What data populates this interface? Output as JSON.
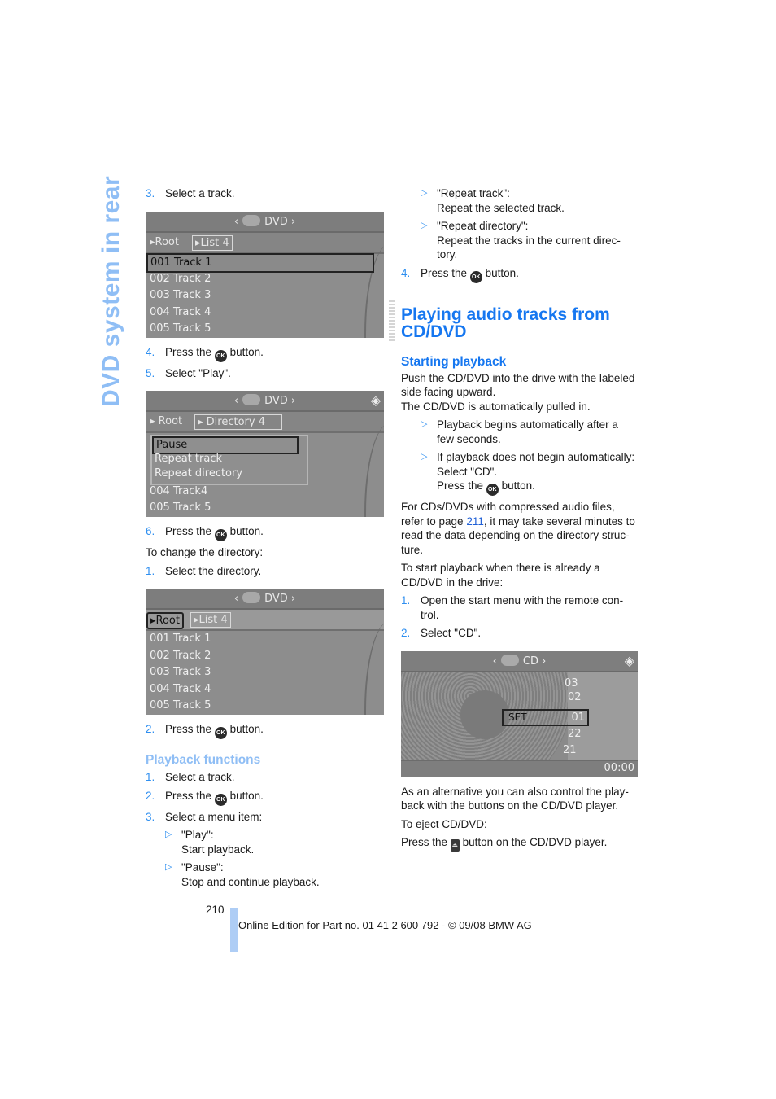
{
  "side_title": "DVD system in rear",
  "left": {
    "step3_select_track": {
      "num": "3.",
      "text": "Select a track."
    },
    "screen1": {
      "source": "DVD",
      "crumbs": [
        "Root",
        "List 4"
      ],
      "rows": [
        "001 Track  1",
        "002 Track  2",
        "003 Track  3",
        "004 Track  4",
        "005 Track  5"
      ],
      "selected_row": "001 Track  1"
    },
    "step4": {
      "num": "4.",
      "text_before": "Press the",
      "text_after": "button."
    },
    "step5": {
      "num": "5.",
      "text": "Select \"Play\"."
    },
    "screen2": {
      "source": "DVD",
      "crumbs": [
        "Root",
        "Directory  4"
      ],
      "popup_items": [
        "Pause",
        "Repeat track",
        "Repeat directory"
      ],
      "rows": [
        "004 Track4",
        "005 Track  5"
      ]
    },
    "step6": {
      "num": "6.",
      "text_before": "Press the",
      "text_after": "button."
    },
    "change_dir_intro": "To change the directory:",
    "change_step1": {
      "num": "1.",
      "text": "Select the directory."
    },
    "screen3": {
      "source": "DVD",
      "crumbs": [
        "Root",
        "List 4"
      ],
      "rows": [
        "001 Track  1",
        "002 Track  2",
        "003 Track  3",
        "004 Track  4",
        "005 Track  5"
      ]
    },
    "change_step2": {
      "num": "2.",
      "text_before": "Press the",
      "text_after": "button."
    },
    "playback_functions": {
      "heading": "Playback functions",
      "steps": [
        {
          "num": "1.",
          "text": "Select a track."
        },
        {
          "num": "2.",
          "text_before": "Press the",
          "text_after": "button."
        },
        {
          "num": "3.",
          "text": "Select a menu item:"
        }
      ],
      "bullets": [
        {
          "title": "\"Play\":",
          "desc": "Start playback."
        },
        {
          "title": "\"Pause\":",
          "desc": "Stop and continue playback."
        }
      ]
    }
  },
  "right": {
    "bullets": [
      {
        "title": "\"Repeat track\":",
        "desc": "Repeat the selected track."
      },
      {
        "title": "\"Repeat directory\":",
        "desc": "Repeat the tracks in the current direc-",
        "desc2": "tory."
      }
    ],
    "step4": {
      "num": "4.",
      "text_before": "Press the",
      "text_after": "button."
    },
    "section_title_line1": "Playing audio tracks from",
    "section_title_line2": "CD/DVD",
    "subheading": "Starting playback",
    "intro_lines": [
      "Push the CD/DVD into the drive with the labeled",
      "side facing upward.",
      "The CD/DVD is automatically pulled in."
    ],
    "start_bullets": [
      {
        "line1": "Playback begins automatically after a",
        "line2": "few seconds."
      },
      {
        "line1": "If playback does not begin automatically:",
        "line2": "Select \"CD\".",
        "line3_before": "Press the",
        "line3_after": "button."
      }
    ],
    "compressed": {
      "line1": "For CDs/DVDs with compressed audio files,",
      "line2_before": "refer to page ",
      "page_link": "211",
      "line2_after": ", it may take several minutes to",
      "line3": "read the data depending on the directory struc-",
      "line4": "ture."
    },
    "already_lines": [
      "To start playback when there is already a",
      "CD/DVD in the drive:"
    ],
    "steps": [
      {
        "num": "1.",
        "line1": "Open the start menu with the remote con-",
        "line2": "trol."
      },
      {
        "num": "2.",
        "line1": "Select \"CD\"."
      }
    ],
    "cd_screen": {
      "source": "CD",
      "tracks_above": [
        "03",
        "02"
      ],
      "set_label": "SET",
      "current_track": "01",
      "tracks_below": [
        "22",
        "21"
      ],
      "time": "00:00"
    },
    "alt_lines": [
      "As an alternative you can also control the play-",
      "back with the buttons on the CD/DVD player."
    ],
    "eject_intro": "To eject CD/DVD:",
    "eject_before": "Press the",
    "eject_after": "button on the CD/DVD player."
  },
  "icons": {
    "ok_label": "OK",
    "eject_glyph": "⏏",
    "triangle": "▷",
    "arrow_left": "‹",
    "arrow_right": "›",
    "nav_glyph": "◈"
  },
  "footer": {
    "page_number": "210",
    "edition": "Online Edition for Part no. 01 41 2 600 792 - © 09/08 BMW AG"
  },
  "colors": {
    "accent": "#1677f0",
    "accent_light": "#8fbef5",
    "link": "#1f5fd6"
  }
}
